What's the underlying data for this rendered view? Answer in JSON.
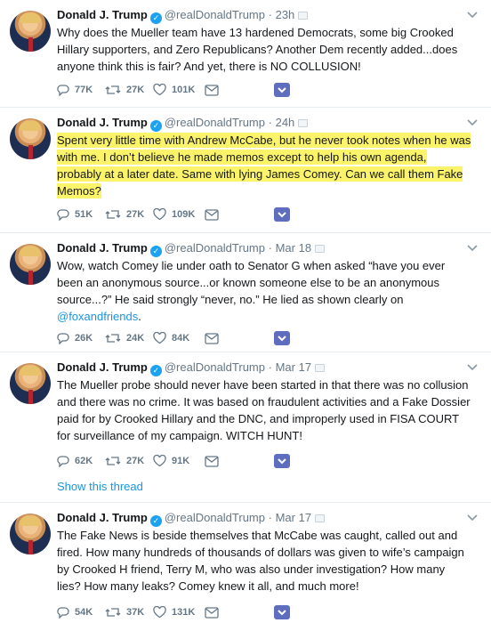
{
  "tweets": [
    {
      "name": "Donald J. Trump",
      "handle": "@realDonaldTrump",
      "sep": "·",
      "time": "23h",
      "text": "Why does the Mueller team have 13 hardened Democrats, some big Crooked Hillary supporters, and Zero Republicans? Another Dem recently added...does anyone think this is fair? And yet, there is NO COLLUSION!",
      "replies": "77K",
      "retweets": "27K",
      "likes": "101K"
    },
    {
      "name": "Donald J. Trump",
      "handle": "@realDonaldTrump",
      "sep": "·",
      "time": "24h",
      "text": "Spent very little time with Andrew McCabe, but he never took notes when he was with me. I don’t believe he made memos except to help his own agenda, probably at a later date. Same with lying James Comey. Can we call them Fake Memos?",
      "highlighted": true,
      "replies": "51K",
      "retweets": "27K",
      "likes": "109K"
    },
    {
      "name": "Donald J. Trump",
      "handle": "@realDonaldTrump",
      "sep": "·",
      "time": "Mar 18",
      "text": "Wow, watch Comey lie under oath to Senator G when asked “have you ever been an anonymous source...or known someone else to be an anonymous source...?” He said strongly “never, no.” He lied as shown clearly on",
      "mention": "@foxandfriends",
      "mention_tail": ".",
      "replies": "26K",
      "retweets": "24K",
      "likes": "84K"
    },
    {
      "name": "Donald J. Trump",
      "handle": "@realDonaldTrump",
      "sep": "·",
      "time": "Mar 17",
      "text": "The Mueller probe should never have been started in that there was no collusion and there was no crime. It was based on fraudulent activities and a Fake Dossier paid for by Crooked Hillary and the DNC, and improperly used in FISA COURT for surveillance of my campaign. WITCH HUNT!",
      "replies": "62K",
      "retweets": "27K",
      "likes": "91K",
      "thread_label": "Show this thread"
    },
    {
      "name": "Donald J. Trump",
      "handle": "@realDonaldTrump",
      "sep": "·",
      "time": "Mar 17",
      "text": "The Fake News is beside themselves that McCabe was caught, called out and fired. How many hundreds of thousands of dollars was given to wife’s campaign by Crooked H friend, Terry M, who was also under investigation? How many lies? How many leaks? Comey knew it all, and much more!",
      "replies": "54K",
      "retweets": "37K",
      "likes": "131K"
    }
  ],
  "icons": {
    "reply": "reply-icon",
    "retweet": "retweet-icon",
    "like": "heart-icon",
    "dm": "direct-message-icon",
    "badge": "analytics-badge-icon",
    "caret": "chevron-down-icon",
    "verified": "verified-badge-icon"
  },
  "colors": {
    "accent": "#1da1f2",
    "link": "#1b95e0",
    "muted": "#657786",
    "highlight": "#fbf36a",
    "badge": "#5f6dbf"
  }
}
